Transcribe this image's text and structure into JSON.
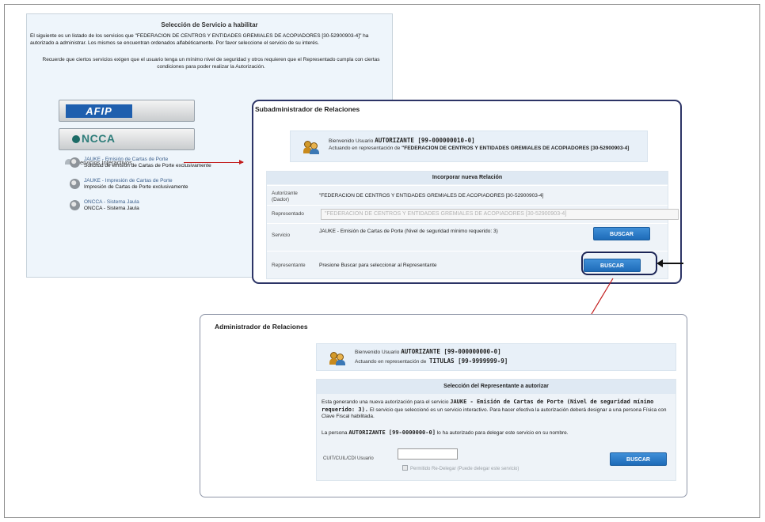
{
  "selection_panel": {
    "title": "Selección de Servicio a habilitar",
    "intro": "El siguiente es un listado de los servicios que \"FEDERACION DE CENTROS Y ENTIDADES GREMIALES DE ACOPIADORES [30-52900903-4]\" ha autorizado a administrar. Los mismos se encuentran ordenados alfabéticamente. Por favor seleccione el servicio de su interés.",
    "requirement_note": "Recuerde que ciertos servicios exigen que el usuario tenga un mínimo nivel de seguridad y otros requieren que el Representado cumpla con ciertas condiciones para poder realizar la Autorización.",
    "afip_label": "AFIP",
    "oncca_label": "NCCA",
    "services_header": "Servicios Interactivos",
    "services": [
      {
        "link": "JAUKE - Emisión de Cartas de Porte",
        "description": "Solicitud de emisión de Cartas de Porte exclusivamente"
      },
      {
        "link": "JAUKE - Impresión de Cartas de Porte",
        "description": "Impresión de Cartas de Porte exclusivamente"
      },
      {
        "link": "ONCCA - Sistema Jaula",
        "description": "ONCCA - Sistema Jaula"
      }
    ]
  },
  "subadmin_panel": {
    "title": "Subadministrador de Relaciones",
    "welcome": {
      "prefix": "Bienvenido Usuario",
      "user": "AUTORIZANTE [99-000000010-0]",
      "acting_prefix": "Actuando en representación de",
      "acting_entity": "\"FEDERACION DE CENTROS Y ENTIDADES GREMIALES DE ACOPIADORES [30-52900903-4]"
    },
    "form_title": "Incorporar nueva Relación",
    "fields": {
      "autorizante_label": "Autorizante (Dador)",
      "autorizante_value": "\"FEDERACION DE CENTROS Y ENTIDADES GREMIALES DE ACOPIADORES [30-52900903-4]",
      "representado_label": "Representado",
      "representado_value": "\"FEDERACION DE CENTROS Y ENTIDADES GREMIALES DE ACOPIADORES [30-52900903-4]",
      "servicio_label": "Servicio",
      "servicio_value": "JAUKE - Emisión de Cartas de Porte (Nivel de seguridad mínimo requerido: 3)",
      "representante_label": "Representante",
      "representante_value": "Presione Buscar para seleccionar al Representante"
    },
    "buscar_label": "BUSCAR"
  },
  "admin_panel": {
    "title": "Administrador de Relaciones",
    "welcome": {
      "prefix": "Bienvenido Usuario",
      "user": "AUTORIZANTE [99-000000000-0]",
      "acting_prefix": "Actuando en representación de",
      "acting_entity": "TITULAS [99-9999999-9]"
    },
    "form_title": "Selección del Representante a autorizar",
    "paragraph_before": "Esta generando una nueva autorización para el servicio",
    "paragraph_service": "JAUKE - Emisión de Cartas de Porte (Nivel de seguridad mínimo requerido: 3).",
    "paragraph_after": "El servicio que seleccionó es un servicio interactivo. Para hacer efectiva la autorización deberá designar a una persona Física con Clave Fiscal habilitada.",
    "delegate_prefix": "La persona",
    "delegate_user": "AUTORIZANTE [99-0000000-0]",
    "delegate_suffix": "lo ha autorizado para delegar este servicio en su nombre.",
    "cuit_label": "CUIT/CUIL/CDI Usuario",
    "cuit_value": "",
    "checkbox_label": "Permitido Re-Delegar (Puede delegar este servicio)",
    "buscar_label": "BUSCAR"
  },
  "colors": {
    "accent_blue": "#1e6bb8",
    "arrow_red": "#c21d1d",
    "panel_border": "#2c3466"
  }
}
